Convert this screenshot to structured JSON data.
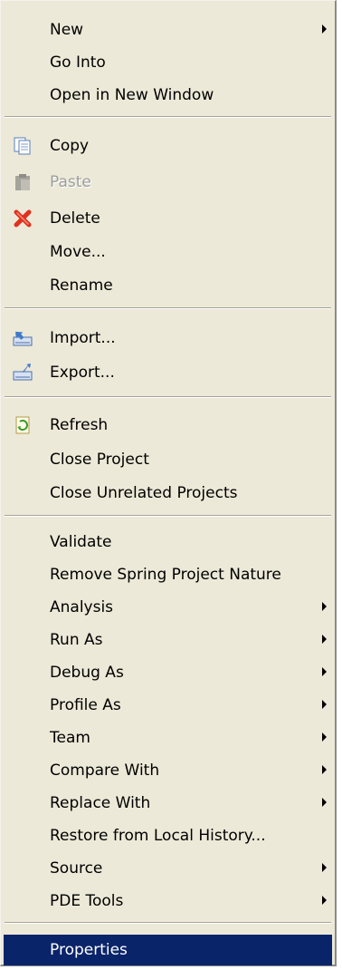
{
  "colors": {
    "menu_background": "#ece9d8",
    "selection_background": "#0a246a",
    "selection_text": "#ffffff",
    "disabled_text": "#9d9d9d",
    "separator": "#a5a399"
  },
  "menu": {
    "items": [
      {
        "label": "New",
        "icon": "",
        "submenu": true,
        "enabled": true,
        "selected": false
      },
      {
        "label": "Go Into",
        "icon": "",
        "submenu": false,
        "enabled": true,
        "selected": false
      },
      {
        "label": "Open in New Window",
        "icon": "",
        "submenu": false,
        "enabled": true,
        "selected": false
      },
      {
        "label": "Copy",
        "icon": "copy-icon",
        "submenu": false,
        "enabled": true,
        "selected": false
      },
      {
        "label": "Paste",
        "icon": "paste-icon",
        "submenu": false,
        "enabled": false,
        "selected": false
      },
      {
        "label": "Delete",
        "icon": "delete-icon",
        "submenu": false,
        "enabled": true,
        "selected": false
      },
      {
        "label": "Move...",
        "icon": "",
        "submenu": false,
        "enabled": true,
        "selected": false
      },
      {
        "label": "Rename",
        "icon": "",
        "submenu": false,
        "enabled": true,
        "selected": false
      },
      {
        "label": "Import...",
        "icon": "import-icon",
        "submenu": false,
        "enabled": true,
        "selected": false
      },
      {
        "label": "Export...",
        "icon": "export-icon",
        "submenu": false,
        "enabled": true,
        "selected": false
      },
      {
        "label": "Refresh",
        "icon": "refresh-icon",
        "submenu": false,
        "enabled": true,
        "selected": false
      },
      {
        "label": "Close Project",
        "icon": "",
        "submenu": false,
        "enabled": true,
        "selected": false
      },
      {
        "label": "Close Unrelated Projects",
        "icon": "",
        "submenu": false,
        "enabled": true,
        "selected": false
      },
      {
        "label": "Validate",
        "icon": "",
        "submenu": false,
        "enabled": true,
        "selected": false
      },
      {
        "label": "Remove Spring Project Nature",
        "icon": "",
        "submenu": false,
        "enabled": true,
        "selected": false
      },
      {
        "label": "Analysis",
        "icon": "",
        "submenu": true,
        "enabled": true,
        "selected": false
      },
      {
        "label": "Run As",
        "icon": "",
        "submenu": true,
        "enabled": true,
        "selected": false
      },
      {
        "label": "Debug As",
        "icon": "",
        "submenu": true,
        "enabled": true,
        "selected": false
      },
      {
        "label": "Profile As",
        "icon": "",
        "submenu": true,
        "enabled": true,
        "selected": false
      },
      {
        "label": "Team",
        "icon": "",
        "submenu": true,
        "enabled": true,
        "selected": false
      },
      {
        "label": "Compare With",
        "icon": "",
        "submenu": true,
        "enabled": true,
        "selected": false
      },
      {
        "label": "Replace With",
        "icon": "",
        "submenu": true,
        "enabled": true,
        "selected": false
      },
      {
        "label": "Restore from Local History...",
        "icon": "",
        "submenu": false,
        "enabled": true,
        "selected": false
      },
      {
        "label": "Source",
        "icon": "",
        "submenu": true,
        "enabled": true,
        "selected": false
      },
      {
        "label": "PDE Tools",
        "icon": "",
        "submenu": true,
        "enabled": true,
        "selected": false
      },
      {
        "label": "Properties",
        "icon": "",
        "submenu": false,
        "enabled": true,
        "selected": true
      }
    ]
  }
}
